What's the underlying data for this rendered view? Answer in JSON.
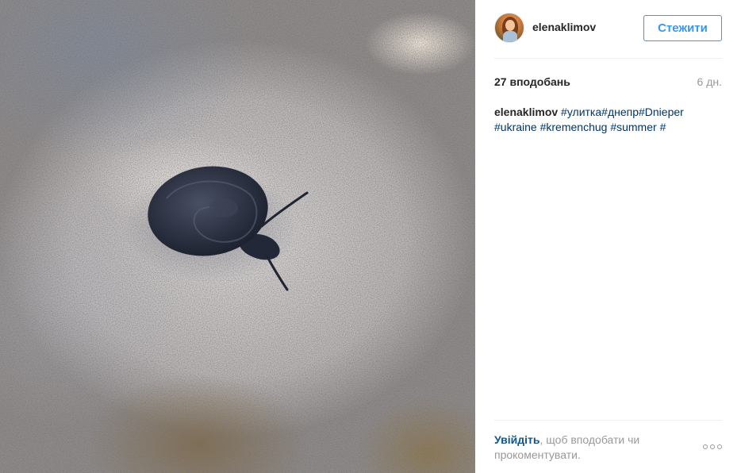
{
  "post": {
    "image_alt": "snail on sand"
  },
  "header": {
    "username": "elenaklimov",
    "follow_label": "Стежити"
  },
  "stats": {
    "likes": "27 вподобань",
    "time_ago": "6 дн."
  },
  "caption": {
    "username": "elenaklimov",
    "tags_line1": [
      "#улитка",
      "#днепр",
      "#Dnieper"
    ],
    "tags_line2": [
      "#ukraine",
      "#kremenchug",
      "#summer",
      "#"
    ]
  },
  "footer": {
    "login_link": "Увійдіть",
    "login_text": ", щоб вподобати чи прокоментувати.",
    "more_icon": "more-dots-icon"
  }
}
